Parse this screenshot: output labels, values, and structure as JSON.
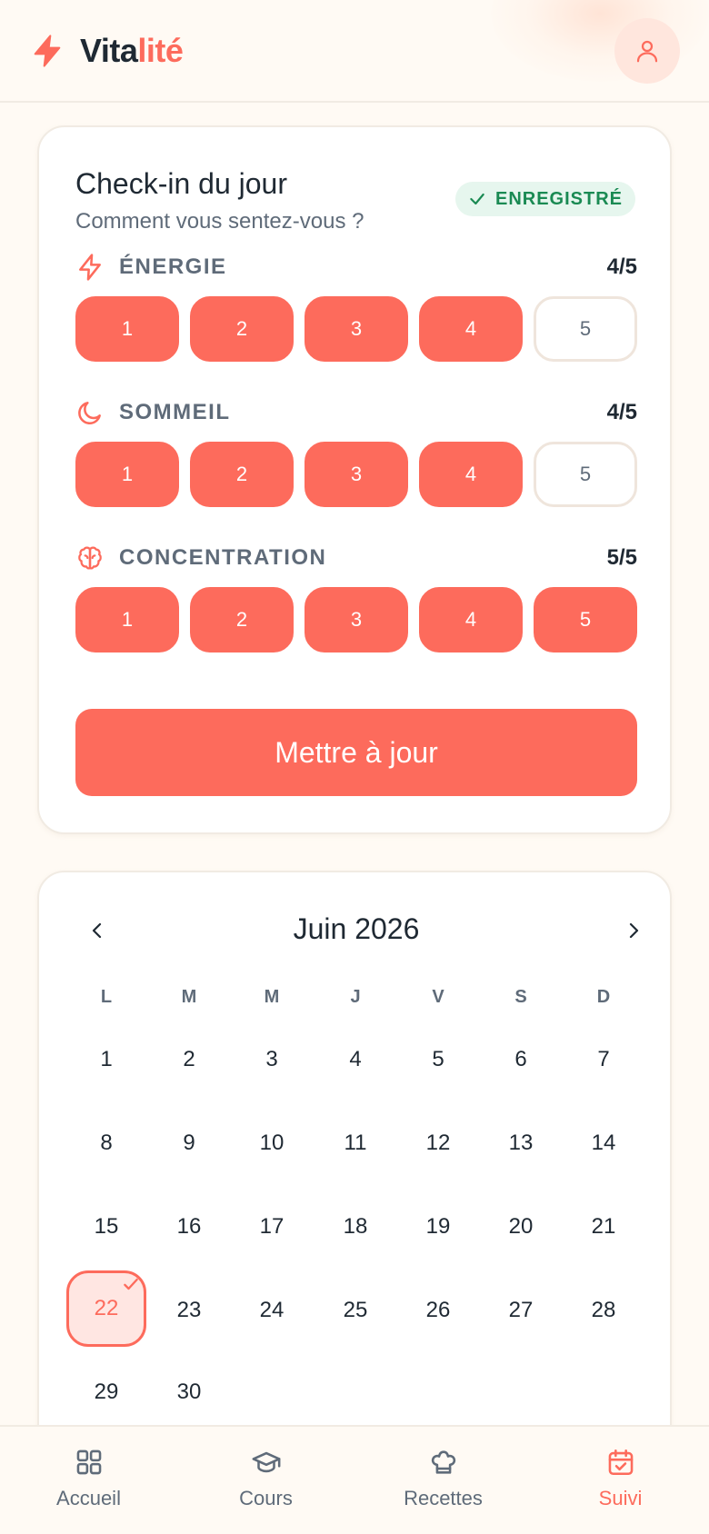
{
  "app": {
    "logo_part1": "Vita",
    "logo_part2": "lité",
    "accent": "#fd6b5c"
  },
  "checkin": {
    "title": "Check-in du jour",
    "subtitle": "Comment vous sentez-vous ?",
    "badge": "ENREGISTRÉ",
    "metrics": [
      {
        "label": "ÉNERGIE",
        "value": "4/5",
        "score": 4,
        "icon": "bolt-icon"
      },
      {
        "label": "SOMMEIL",
        "value": "4/5",
        "score": 4,
        "icon": "moon-icon"
      },
      {
        "label": "CONCENTRATION",
        "value": "5/5",
        "score": 5,
        "icon": "brain-icon"
      }
    ],
    "options": [
      "1",
      "2",
      "3",
      "4",
      "5"
    ],
    "update_label": "Mettre à jour"
  },
  "calendar": {
    "title": "Juin 2026",
    "weekdays": [
      "L",
      "M",
      "M",
      "J",
      "V",
      "S",
      "D"
    ],
    "days": [
      "1",
      "2",
      "3",
      "4",
      "5",
      "6",
      "7",
      "8",
      "9",
      "10",
      "11",
      "12",
      "13",
      "14",
      "15",
      "16",
      "17",
      "18",
      "19",
      "20",
      "21",
      "22",
      "23",
      "24",
      "25",
      "26",
      "27",
      "28",
      "29",
      "30"
    ],
    "selected_day": "22"
  },
  "tabs": [
    {
      "label": "Accueil",
      "icon": "grid-icon"
    },
    {
      "label": "Cours",
      "icon": "graduation-cap-icon"
    },
    {
      "label": "Recettes",
      "icon": "chef-hat-icon"
    },
    {
      "label": "Suivi",
      "icon": "calendar-check-icon",
      "active": true
    }
  ]
}
